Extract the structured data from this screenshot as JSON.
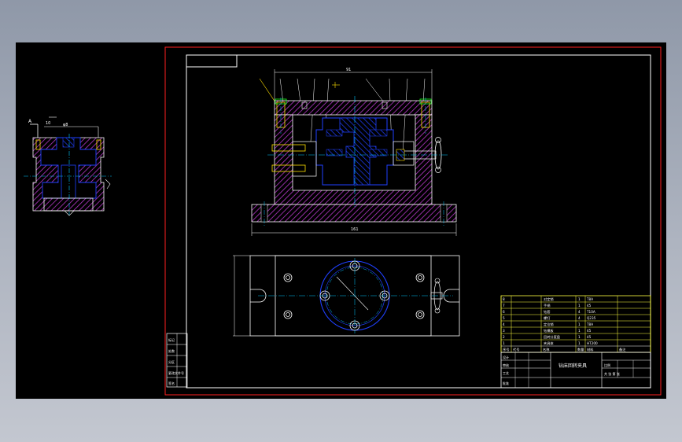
{
  "drawing": {
    "colors": {
      "background": "#000000",
      "frame_outer": "#ff2020",
      "frame_inner": "#ffffff",
      "part_outline": "#ffffff",
      "hatch": "#c03ad0",
      "section_blue": "#2040ff",
      "bolt_yellow": "#ffe000",
      "center_line": "#00c8ff",
      "title_block": "#ffff40",
      "arrow_green": "#20ff20"
    },
    "dimensions": {
      "top_width": "91",
      "base_width": "161",
      "hole_label": "φ8",
      "detail_a": "A",
      "detail_dim": "10"
    },
    "title_block": {
      "drawing_title": "钻床回转夹具",
      "parts": [
        {
          "no": "1",
          "name": "夹具体",
          "qty": "1",
          "material": "HT200"
        },
        {
          "no": "2",
          "name": "回转分度盘",
          "qty": "1",
          "material": "45"
        },
        {
          "no": "3",
          "name": "钻模板",
          "qty": "1",
          "material": "45"
        },
        {
          "no": "4",
          "name": "定位销",
          "qty": "1",
          "material": "T8A"
        },
        {
          "no": "5",
          "name": "螺钉",
          "qty": "4",
          "material": "Q235"
        },
        {
          "no": "6",
          "name": "钻套",
          "qty": "4",
          "material": "T10A"
        },
        {
          "no": "7",
          "name": "手柄",
          "qty": "1",
          "material": "45"
        },
        {
          "no": "8",
          "name": "对定销",
          "qty": "1",
          "material": "T8A"
        }
      ],
      "header": [
        "序号",
        "代号",
        "名称",
        "数量",
        "材料",
        "备注"
      ],
      "signature_rows": [
        "设计",
        "审核",
        "工艺",
        "批准"
      ],
      "scale_label": "比例",
      "sheet_label": "共 张 第 张"
    },
    "side_revision": {
      "rows": [
        "标记",
        "处数",
        "分区",
        "更改文件号",
        "签名"
      ]
    }
  }
}
